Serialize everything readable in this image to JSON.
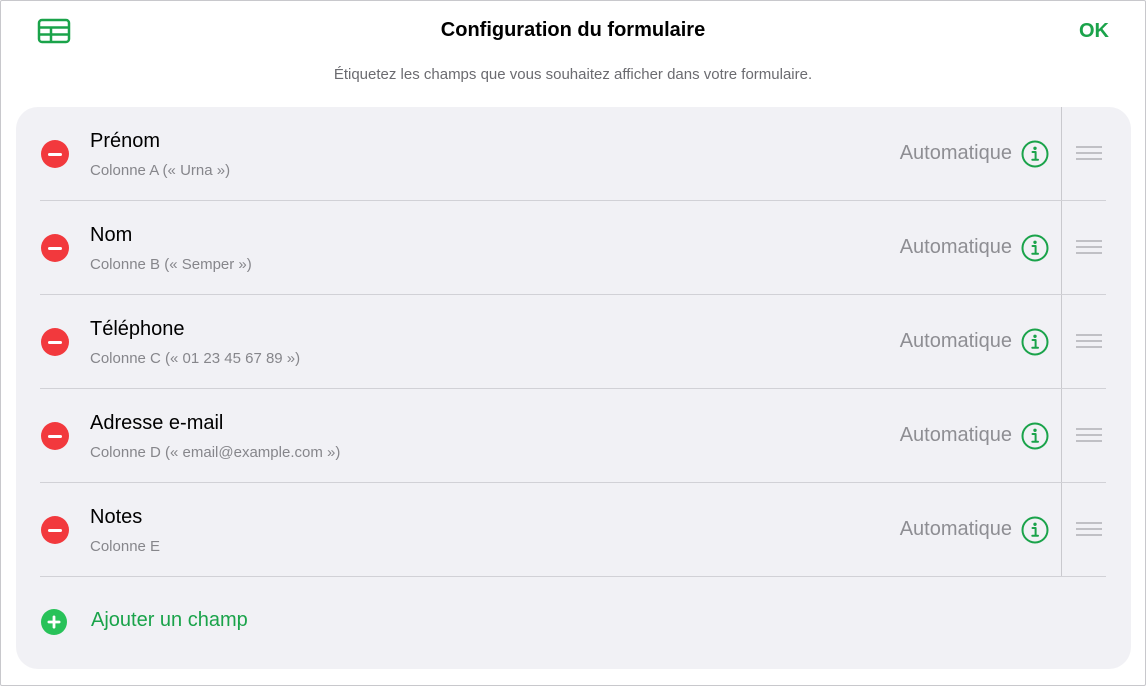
{
  "header": {
    "title": "Configuration du formulaire",
    "subtitle": "Étiquetez les champs que vous souhaitez afficher dans votre formulaire.",
    "ok_label": "OK"
  },
  "fields": [
    {
      "name": "Prénom",
      "column": "Colonne A (« Urna »)",
      "type": "Automatique"
    },
    {
      "name": "Nom",
      "column": "Colonne B (« Semper »)",
      "type": "Automatique"
    },
    {
      "name": "Téléphone",
      "column": "Colonne C (« 01 23 45 67 89 »)",
      "type": "Automatique"
    },
    {
      "name": "Adresse e-mail",
      "column": "Colonne D (« email@example.com »)",
      "type": "Automatique"
    },
    {
      "name": "Notes",
      "column": "Colonne E",
      "type": "Automatique"
    }
  ],
  "add_field": {
    "label": "Ajouter un champ"
  },
  "colors": {
    "accent": "#1aa34a",
    "remove": "#f2393d",
    "panel_bg": "#f1f1f5",
    "secondary_text": "#86868b"
  },
  "icons": {
    "table": "table-icon",
    "remove": "minus-circle-icon",
    "info": "info-circle-icon",
    "drag": "drag-handle-icon",
    "add": "plus-circle-icon"
  }
}
